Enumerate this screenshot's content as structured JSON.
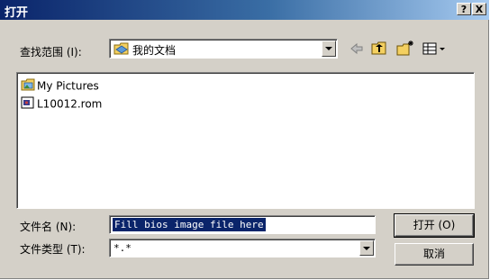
{
  "window": {
    "title": "打开",
    "help_label": "?",
    "close_label": "X"
  },
  "lookin": {
    "label": "查找范围 (I):",
    "value": "我的文档"
  },
  "files": [
    {
      "name": "My Pictures",
      "icon": "folder-pictures-icon"
    },
    {
      "name": "L10012.rom",
      "icon": "rom-file-icon"
    }
  ],
  "filename": {
    "label": "文件名 (N):",
    "value": "Fill bios image file here"
  },
  "filetype": {
    "label": "文件类型 (T):",
    "value": "*.*"
  },
  "buttons": {
    "open": "打开 (O)",
    "cancel": "取消"
  }
}
